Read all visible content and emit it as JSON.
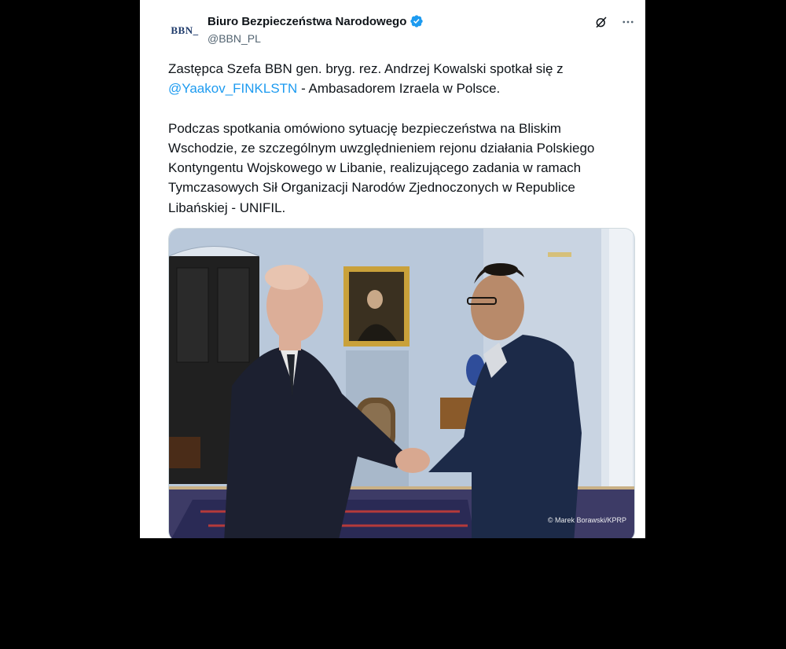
{
  "tweet": {
    "avatar_text": "BBN",
    "display_name": "Biuro Bezpieczeństwa Narodowego",
    "handle": "@BBN_PL",
    "text_part1": "Zastępca Szefa BBN gen. bryg. rez. Andrzej Kowalski spotkał się z ",
    "mention": "@Yaakov_FINKLSTN",
    "text_part2": " - Ambasadorem Izraela w Polsce.",
    "paragraph2": "Podczas spotkania omówiono sytuację bezpieczeństwa na Bliskim Wschodzie, ze szczególnym uwzględnieniem rejonu działania Polskiego Kontyngentu Wojskowego w Libanie, realizującego zadania w ramach Tymczasowych Sił Organizacji Narodów Zjednoczonych w Republice Libańskiej - UNIFIL.",
    "photo_credit": "© Marek Borawski/KPRP"
  },
  "icons": {
    "verified": "verified-badge-icon",
    "grok": "grok-icon",
    "more": "more-icon"
  },
  "colors": {
    "mention": "#1d9bf0",
    "verified": "#1d9bf0",
    "text": "#0f1419",
    "secondary": "#536471"
  }
}
